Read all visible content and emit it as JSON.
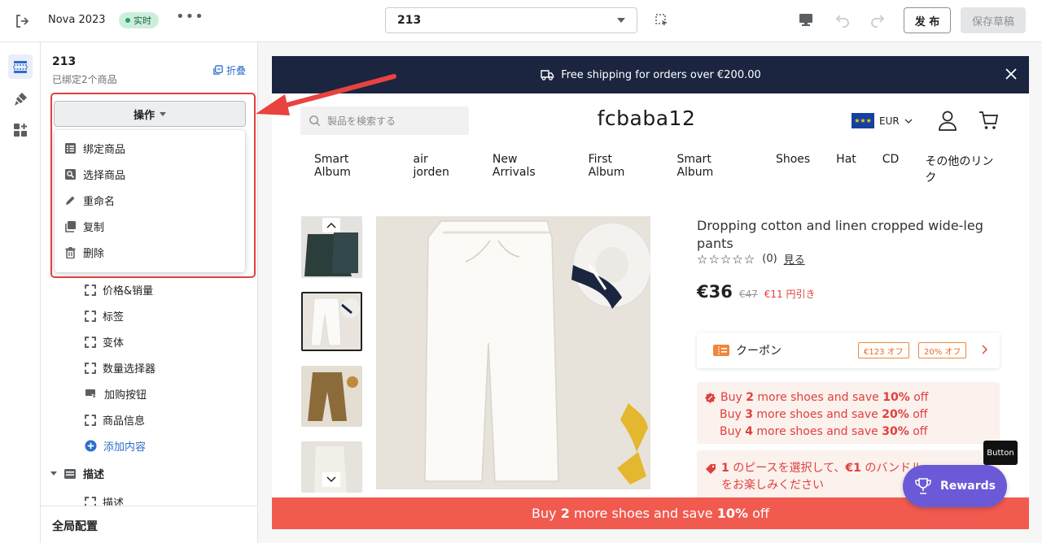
{
  "topbar": {
    "store_name": "Nova 2023",
    "status_badge": "实时",
    "more": "•••",
    "page_select": "213",
    "publish_label": "发 布",
    "save_draft_label": "保存草稿"
  },
  "panel": {
    "title": "213",
    "subtitle": "已绑定2个商品",
    "collapse_label": "折叠",
    "operation_button": "操作",
    "menu": [
      {
        "label": "绑定商品",
        "icon": "list-icon"
      },
      {
        "label": "选择商品",
        "icon": "search-list-icon"
      },
      {
        "label": "重命名",
        "icon": "pencil-icon"
      },
      {
        "label": "复制",
        "icon": "duplicate-icon"
      },
      {
        "label": "删除",
        "icon": "trash-icon"
      }
    ],
    "tree": [
      {
        "label": "价格&销量",
        "icon": "frame-icon"
      },
      {
        "label": "标签",
        "icon": "frame-icon"
      },
      {
        "label": "变体",
        "icon": "frame-icon"
      },
      {
        "label": "数量选择器",
        "icon": "frame-icon"
      },
      {
        "label": "加购按钮",
        "icon": "cart-button-icon"
      },
      {
        "label": "商品信息",
        "icon": "frame-icon"
      }
    ],
    "add_content": "添加内容",
    "description_section": "描述",
    "description_child": "描述",
    "global_config": "全局配置"
  },
  "store": {
    "announcement": "Free shipping for orders over €200.00",
    "search_placeholder": "製品を検索する",
    "logo": "fcbaba12",
    "currency": "EUR",
    "nav": [
      "Smart Album",
      "air jorden",
      "New Arrivals",
      "First Album",
      "Smart Album",
      "Shoes",
      "Hat",
      "CD",
      "その他のリンク"
    ],
    "product": {
      "title": "Dropping cotton and linen cropped wide-leg pants",
      "rating_count": "(0)",
      "see_reviews": "見る",
      "price": "€36",
      "compare_price": "€47",
      "discount": "€11 円引き",
      "rating": 0
    },
    "coupon": {
      "label": "クーポン",
      "tag1": "€123 オフ",
      "tag2": "20% オフ"
    },
    "promo": [
      {
        "pre": "Buy ",
        "qty": "2",
        "mid": " more shoes and save ",
        "pct": "10%",
        "post": " off"
      },
      {
        "pre": "Buy ",
        "qty": "3",
        "mid": " more shoes and save ",
        "pct": "20%",
        "post": " off"
      },
      {
        "pre": "Buy ",
        "qty": "4",
        "mid": " more shoes and save ",
        "pct": "30%",
        "post": " off"
      }
    ],
    "bundle": {
      "num": "1",
      "text1": " のピースを選択して、",
      "amount": "€1",
      "text2": " のバンドル",
      "line2": "をお楽しみください"
    },
    "bottom_bar": {
      "pre": "Buy ",
      "qty": "2",
      "mid": " more shoes and save ",
      "pct": "10%",
      "post": " off"
    }
  },
  "tooltip": "Button",
  "rewards_label": "Rewards",
  "colors": {
    "highlight": "#e0403e",
    "announcement_bg": "#1b2540",
    "promo_red": "#e0403e",
    "rewards": "#6a5ad7"
  }
}
